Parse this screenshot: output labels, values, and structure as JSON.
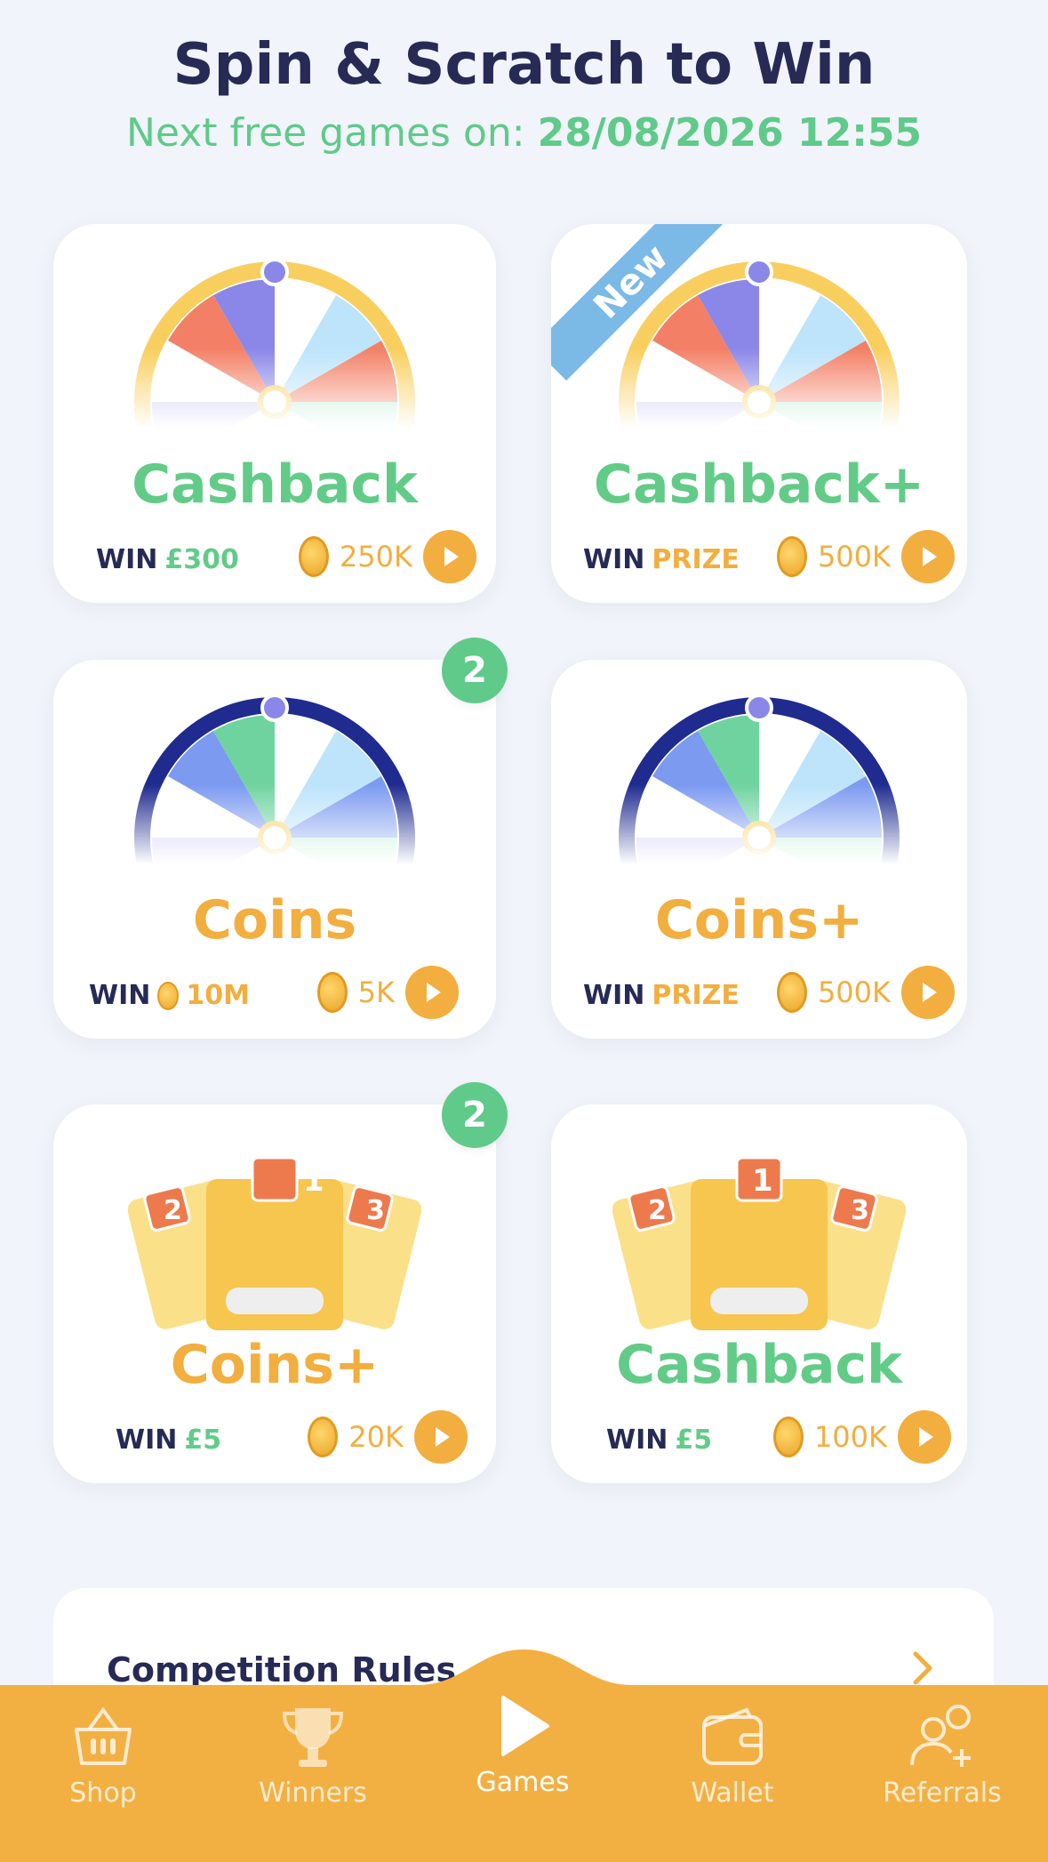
{
  "header": {
    "title": "Spin & Scratch to Win",
    "subtitle_prefix": "Next free games on: ",
    "subtitle_date": "28/08/2026 12:55"
  },
  "colors": {
    "green": "#5fca89",
    "orange": "#f2ae3e",
    "navy": "#262a55",
    "background": "#f1f4fa"
  },
  "cards": [
    {
      "title": "Cashback",
      "win_label": "WIN",
      "win_value": "£300",
      "cost": "250K",
      "badge": null
    },
    {
      "title": "Cashback+",
      "ribbon": "New",
      "win_label": "WIN",
      "win_value": "PRIZE",
      "cost": "500K"
    },
    {
      "title": "Coins",
      "badge": "2",
      "win_label": "WIN",
      "win_value": "10M",
      "cost": "5K"
    },
    {
      "title": "Coins+",
      "win_label": "WIN",
      "win_value": "PRIZE",
      "cost": "500K"
    },
    {
      "title": "Coins+",
      "badge": "2",
      "win_label": "WIN",
      "win_value": "£5",
      "cost": "20K"
    },
    {
      "title": "Cashback",
      "win_label": "WIN",
      "win_value": "£5",
      "cost": "100K"
    }
  ],
  "scratch_numbers": [
    "2",
    "1",
    "3"
  ],
  "rules": {
    "label": "Competition Rules"
  },
  "nav": [
    {
      "label": "Shop",
      "icon": "basket-icon"
    },
    {
      "label": "Winners",
      "icon": "trophy-icon"
    },
    {
      "label": "Games",
      "icon": "play-icon",
      "active": true
    },
    {
      "label": "Wallet",
      "icon": "wallet-icon"
    },
    {
      "label": "Referrals",
      "icon": "add-user-icon"
    }
  ]
}
